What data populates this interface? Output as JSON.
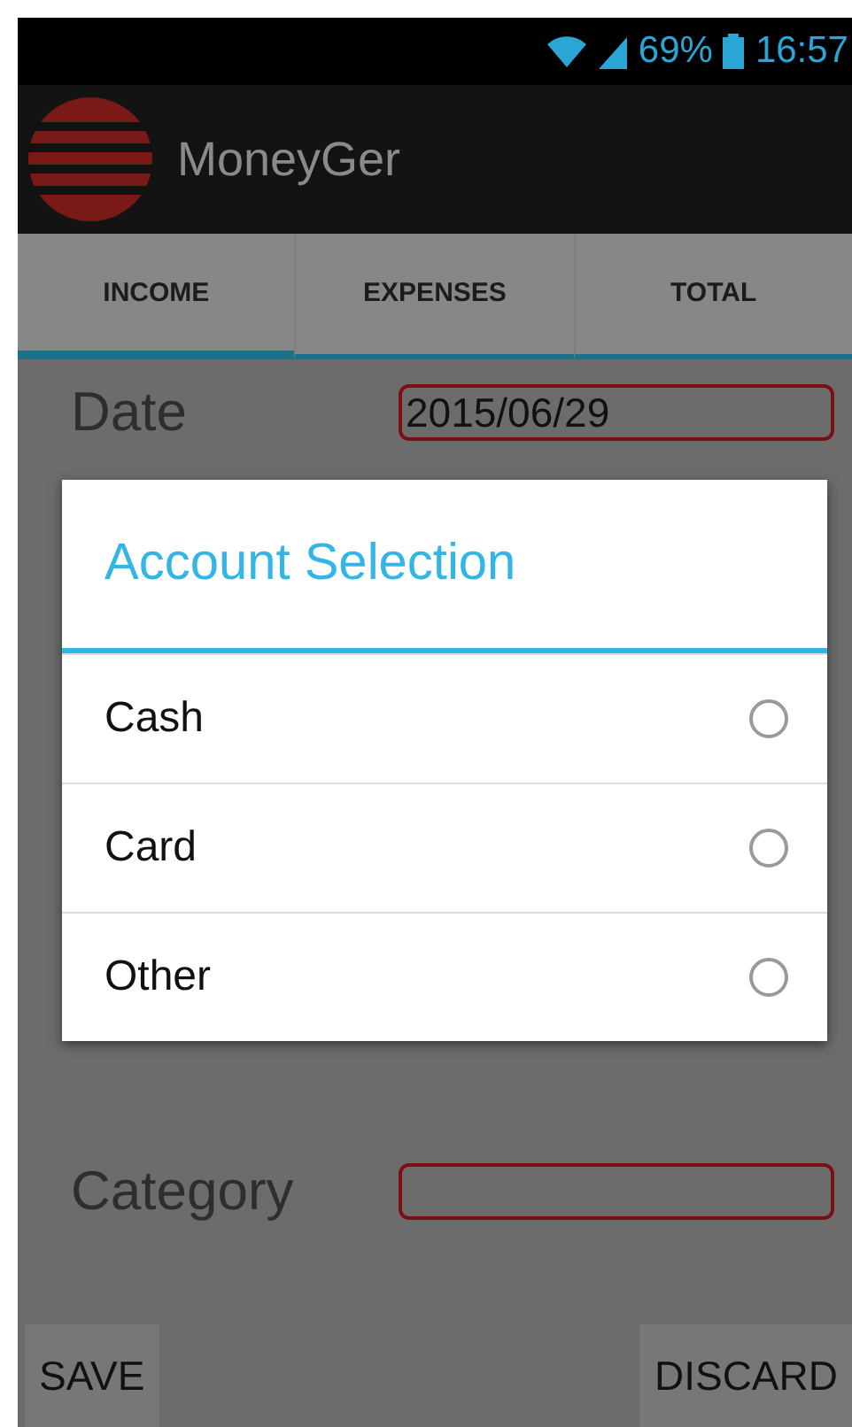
{
  "status_bar": {
    "battery": "69%",
    "time": "16:57"
  },
  "app_bar": {
    "title": "MoneyGer"
  },
  "tabs": [
    {
      "label": "INCOME",
      "selected": true
    },
    {
      "label": "EXPENSES",
      "selected": false
    },
    {
      "label": "TOTAL",
      "selected": false
    }
  ],
  "form": {
    "fields": [
      {
        "label": "Date",
        "value": "2015/06/29"
      },
      {
        "label": "Category"
      }
    ]
  },
  "dialog": {
    "title": "Account Selection",
    "options": [
      {
        "label": "Cash",
        "selected": false
      },
      {
        "label": "Card",
        "selected": false
      },
      {
        "label": "Other",
        "selected": false
      }
    ]
  },
  "buttons": [
    "SAVE",
    "DISCARD"
  ]
}
